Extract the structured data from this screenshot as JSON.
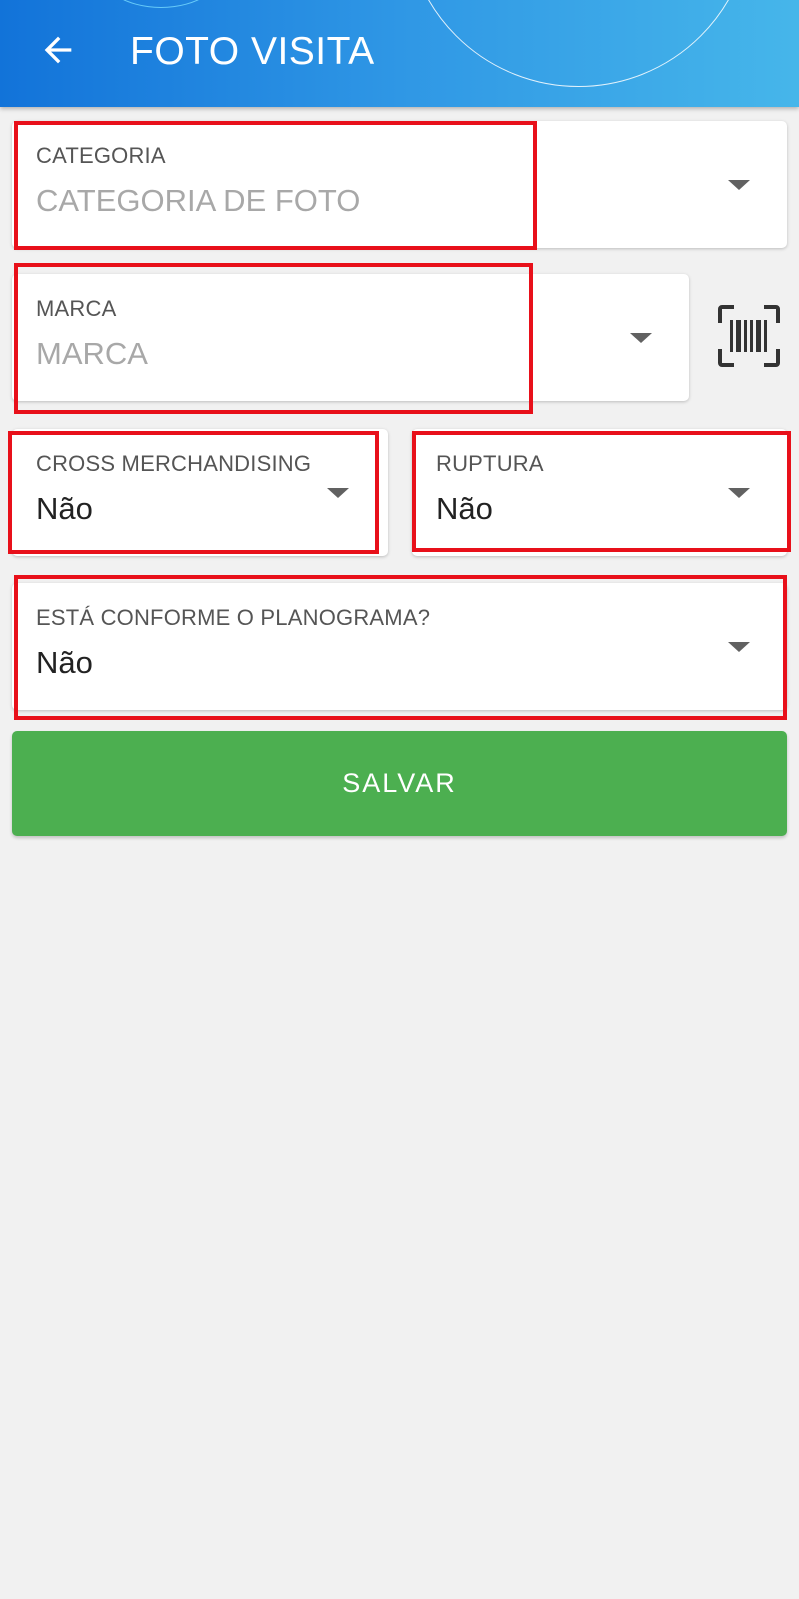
{
  "app_bar": {
    "title": "FOTO VISITA",
    "back_icon": "arrow-back-icon",
    "gradient_colors": [
      "#1273d9",
      "#46b6ea"
    ]
  },
  "form": {
    "categoria": {
      "label": "CATEGORIA",
      "placeholder": "CATEGORIA DE FOTO",
      "value": ""
    },
    "marca": {
      "label": "MARCA",
      "placeholder": "MARCA",
      "value": ""
    },
    "barcode_icon": "barcode-scan-icon",
    "cross_merchandising": {
      "label": "CROSS MERCHANDISING",
      "value": "Não"
    },
    "ruptura": {
      "label": "RUPTURA",
      "value": "Não"
    },
    "planograma": {
      "label": "ESTÁ CONFORME O PLANOGRAMA?",
      "value": "Não"
    }
  },
  "actions": {
    "save_label": "SALVAR",
    "save_color": "#4caf50"
  },
  "annotations": {
    "highlight_color": "#e8101a"
  }
}
